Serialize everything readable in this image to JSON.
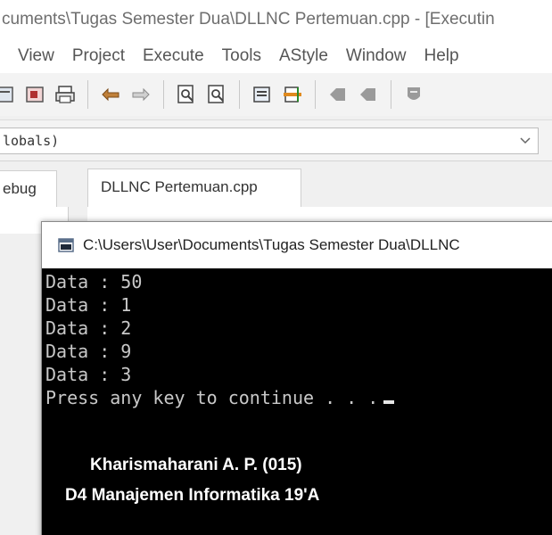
{
  "window": {
    "title": "cuments\\Tugas Semester Dua\\DLLNC Pertemuan.cpp - [Executin"
  },
  "menu": {
    "items": [
      "View",
      "Project",
      "Execute",
      "Tools",
      "AStyle",
      "Window",
      "Help"
    ]
  },
  "toolbar": {
    "icons": [
      "compile-icon",
      "run-icon",
      "print-icon",
      "undo-icon",
      "redo-icon",
      "find-icon",
      "replace-icon",
      "window-icon",
      "goto-icon",
      "bookmark-back-icon",
      "bookmark-forward-icon",
      "shield-icon"
    ]
  },
  "scope_combo": {
    "value": "lobals)"
  },
  "left_tab": {
    "label": "ebug"
  },
  "editor": {
    "file_tab": "DLLNC Pertemuan.cpp"
  },
  "console": {
    "title": "C:\\Users\\User\\Documents\\Tugas Semester Dua\\DLLNC",
    "lines": [
      "Data : 50",
      "Data : 1",
      "Data : 2",
      "Data : 9",
      "Data : 3",
      "Press any key to continue . . ."
    ]
  },
  "overlay": {
    "name": "Kharismaharani A. P. (015)",
    "program": "D4 Manajemen Informatika 19'A"
  },
  "colors": {
    "console_bg": "#000000",
    "console_text": "#c8c8c8",
    "overlay_text": "#ffffff"
  }
}
